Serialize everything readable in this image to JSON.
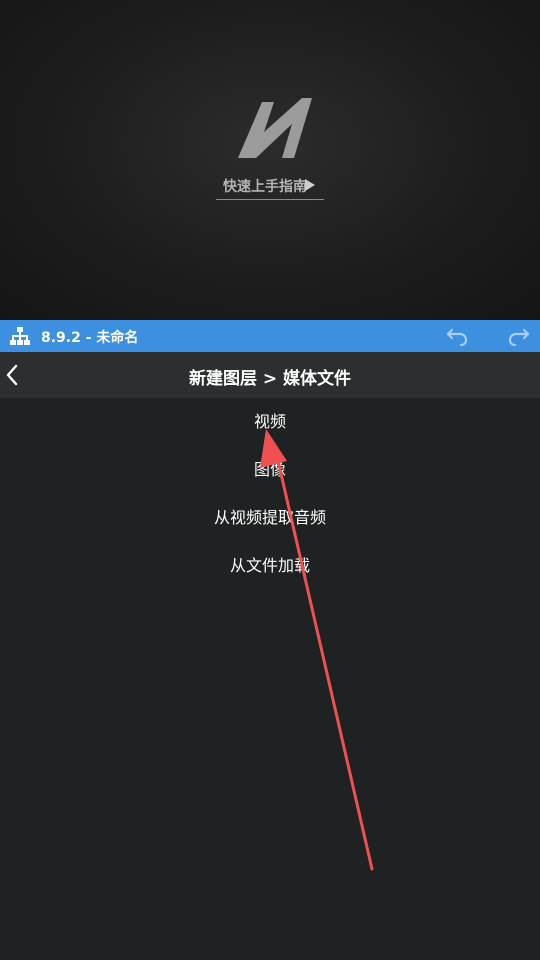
{
  "preview": {
    "guide_label": "快速上手指南"
  },
  "status_bar": {
    "title": "8.9.2 - 未命名",
    "color": "#3d8fe0"
  },
  "header": {
    "title": "新建图层 > 媒体文件"
  },
  "menu": {
    "items": [
      {
        "label": "视频"
      },
      {
        "label": "图像"
      },
      {
        "label": "从视频提取音频"
      },
      {
        "label": "从文件加载"
      }
    ]
  },
  "icons": {
    "logo": "app-logo-icon",
    "play": "play-icon",
    "tree": "layer-tree-icon",
    "undo": "undo-icon",
    "redo": "redo-icon",
    "back": "chevron-left-icon"
  },
  "annotation": {
    "arrow_color": "#f05050"
  }
}
